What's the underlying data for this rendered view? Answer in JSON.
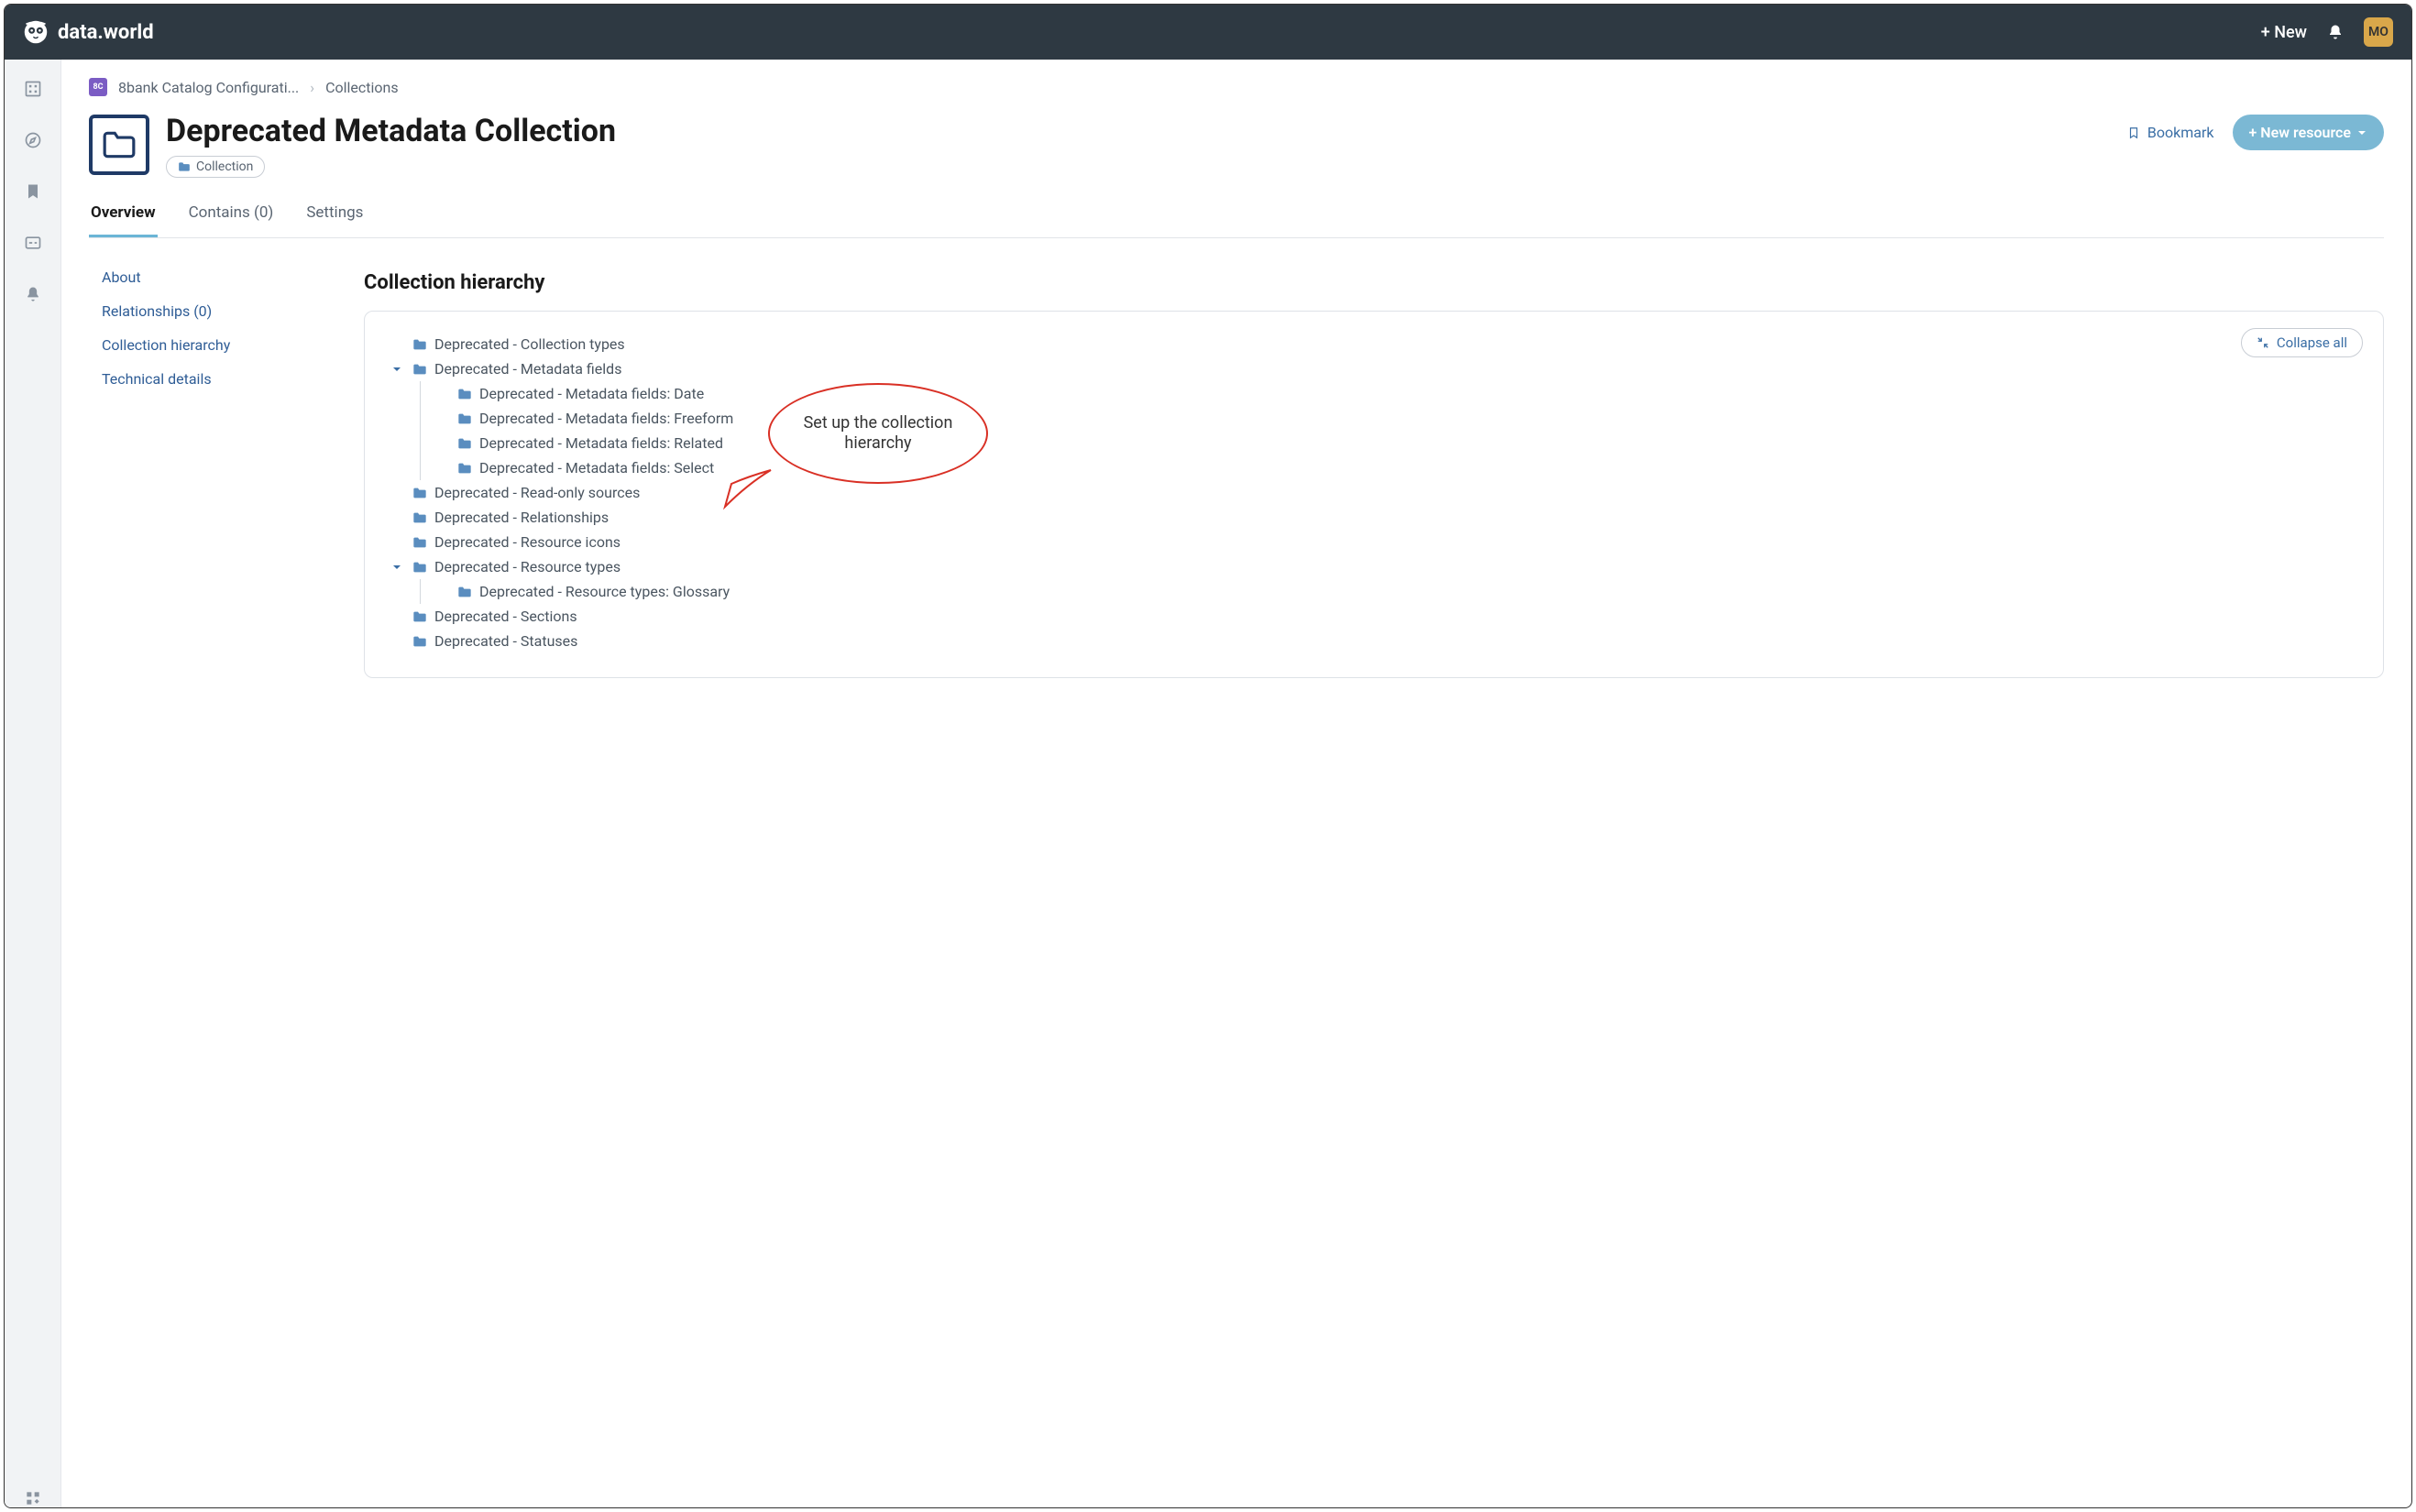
{
  "topbar": {
    "brand": "data.world",
    "new_label": "+ New",
    "avatar_initials": "MO"
  },
  "breadcrumb": {
    "badge_text": "8C",
    "item1": "8bank Catalog Configurati...",
    "item2": "Collections"
  },
  "page": {
    "title": "Deprecated Metadata Collection",
    "type_chip": "Collection",
    "bookmark_label": "Bookmark",
    "new_resource_label": "+ New resource"
  },
  "tabs": {
    "overview": "Overview",
    "contains": "Contains (0)",
    "settings": "Settings"
  },
  "sidebar_nav": {
    "about": "About",
    "relationships": "Relationships (0)",
    "hierarchy": "Collection hierarchy",
    "technical": "Technical details"
  },
  "section": {
    "title": "Collection hierarchy",
    "collapse_label": "Collapse all"
  },
  "tree": {
    "n0": "Deprecated - Collection types",
    "n1": "Deprecated - Metadata fields",
    "n1_0": "Deprecated - Metadata fields: Date",
    "n1_1": "Deprecated - Metadata fields: Freeform",
    "n1_2": "Deprecated - Metadata fields: Related",
    "n1_3": "Deprecated - Metadata fields: Select",
    "n2": "Deprecated - Read-only sources",
    "n3": "Deprecated - Relationships",
    "n4": "Deprecated - Resource icons",
    "n5": "Deprecated - Resource types",
    "n5_0": "Deprecated - Resource types: Glossary",
    "n6": "Deprecated - Sections",
    "n7": "Deprecated - Statuses"
  },
  "annotation": {
    "text": "Set up the collection hierarchy"
  }
}
